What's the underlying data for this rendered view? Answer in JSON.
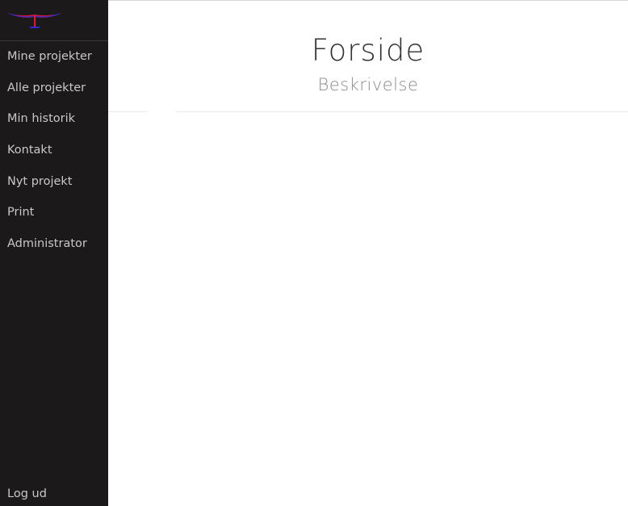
{
  "sidebar": {
    "logo_icon": "glider-logo-icon",
    "items": [
      {
        "label": "Mine projekter"
      },
      {
        "label": "Alle projekter"
      },
      {
        "label": "Min historik"
      },
      {
        "label": "Kontakt"
      },
      {
        "label": "Nyt projekt"
      },
      {
        "label": "Print"
      },
      {
        "label": "Administrator"
      }
    ],
    "logout_label": "Log ud"
  },
  "main": {
    "title": "Forside",
    "subtitle": "Beskrivelse"
  },
  "colors": {
    "sidebar_bg": "#1b191a",
    "sidebar_text": "#c9c7c8",
    "logo_red": "#d8183a",
    "logo_blue": "#2c2bd4"
  }
}
